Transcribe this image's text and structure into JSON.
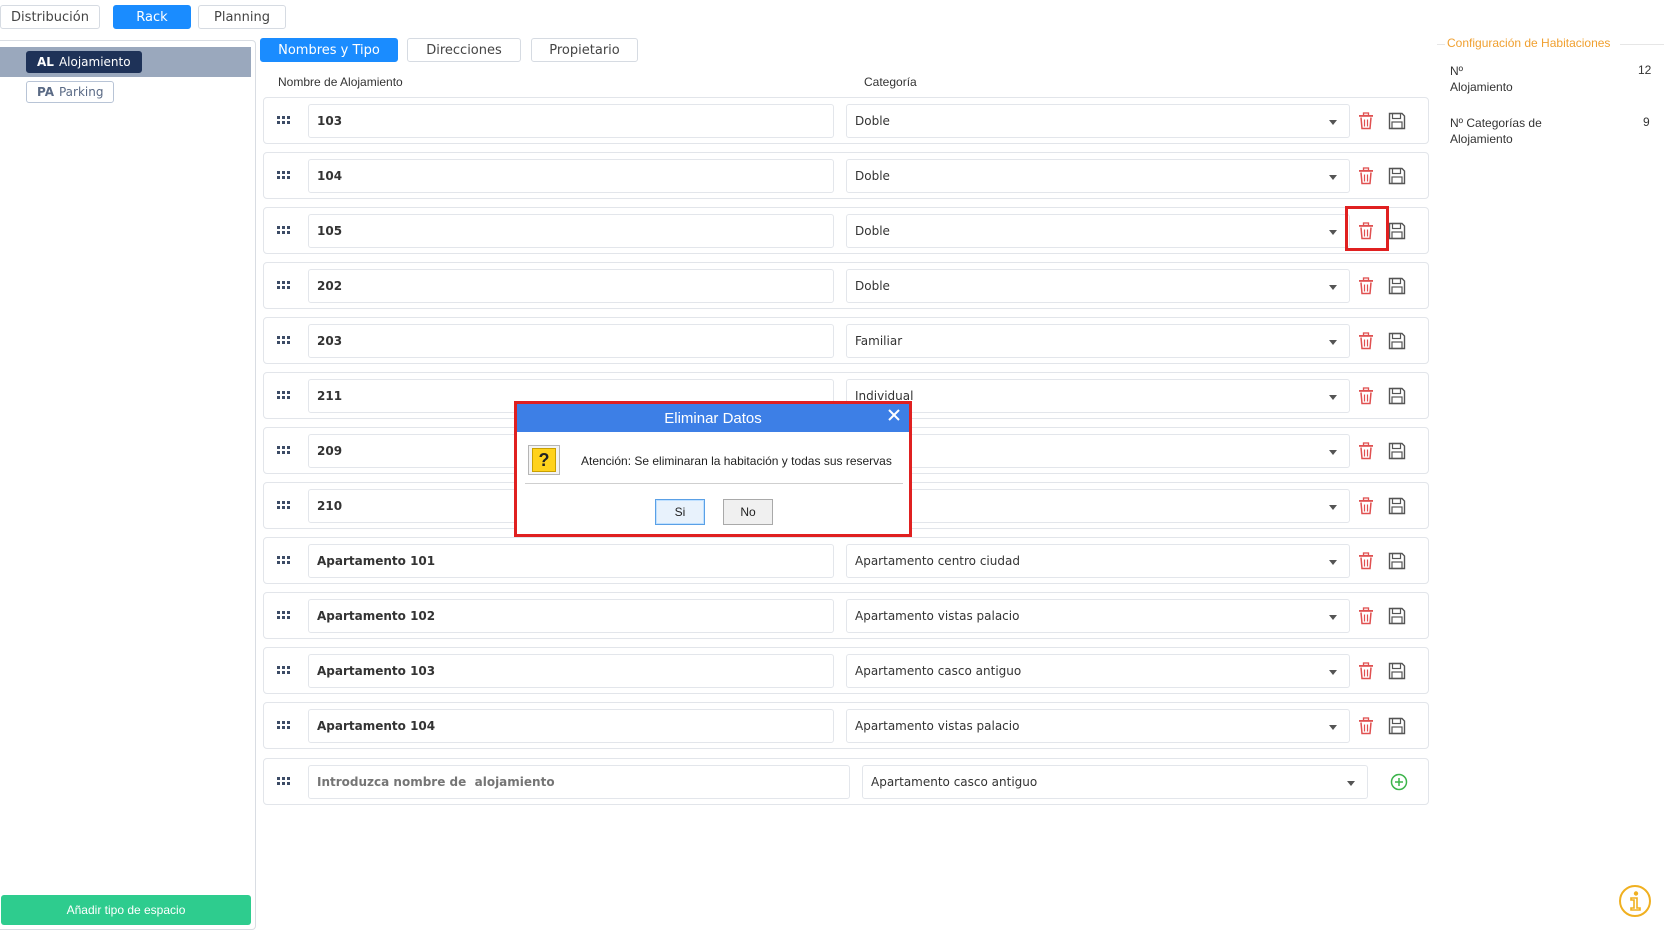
{
  "top_tabs": [
    {
      "label": "Distribución",
      "active": false
    },
    {
      "label": "Rack",
      "active": true
    },
    {
      "label": "Planning",
      "active": false
    }
  ],
  "left_panel": {
    "chips": [
      {
        "code": "AL",
        "label": "Alojamiento",
        "selected": true
      },
      {
        "code": "PA",
        "label": "Parking",
        "selected": false
      }
    ],
    "add_button": "Añadir tipo de espacio"
  },
  "sub_tabs": [
    {
      "label": "Nombres y  Tipo",
      "active": true
    },
    {
      "label": "Direcciones",
      "active": false
    },
    {
      "label": "Propietario",
      "active": false
    }
  ],
  "columns": {
    "name": "Nombre de  Alojamiento",
    "category": "Categoría"
  },
  "rows": [
    {
      "name": "103",
      "category": "Doble"
    },
    {
      "name": "104",
      "category": "Doble"
    },
    {
      "name": "105",
      "category": "Doble"
    },
    {
      "name": "202",
      "category": "Doble"
    },
    {
      "name": "203",
      "category": "Familiar"
    },
    {
      "name": "211",
      "category": "Individual"
    },
    {
      "name": "209",
      "category": ""
    },
    {
      "name": "210",
      "category": ""
    },
    {
      "name": "Apartamento 101",
      "category": "Apartamento centro ciudad"
    },
    {
      "name": "Apartamento 102",
      "category": "Apartamento vistas palacio"
    },
    {
      "name": "Apartamento 103",
      "category": "Apartamento casco antiguo"
    },
    {
      "name": "Apartamento 104",
      "category": "Apartamento vistas palacio"
    }
  ],
  "new_row": {
    "placeholder": "Introduzca nombre de  alojamiento",
    "category": "Apartamento casco antiguo"
  },
  "config": {
    "title": "Configuración de Habitaciones",
    "items": [
      {
        "label_line1": "Nº",
        "label_line2": "Alojamiento",
        "value": "12"
      },
      {
        "label_line1": "Nº Categorías de",
        "label_line2": "Alojamiento",
        "value": "9"
      }
    ]
  },
  "modal": {
    "title": "Eliminar Datos",
    "message": "Atención: Se eliminaran la habitación y todas sus reservas",
    "yes_label": "Si",
    "no_label": "No"
  },
  "colors": {
    "accent": "#1a8cff",
    "delete": "#e05050",
    "add": "#2ecc8e",
    "config_title": "#f0a030",
    "highlight": "#e02020"
  }
}
